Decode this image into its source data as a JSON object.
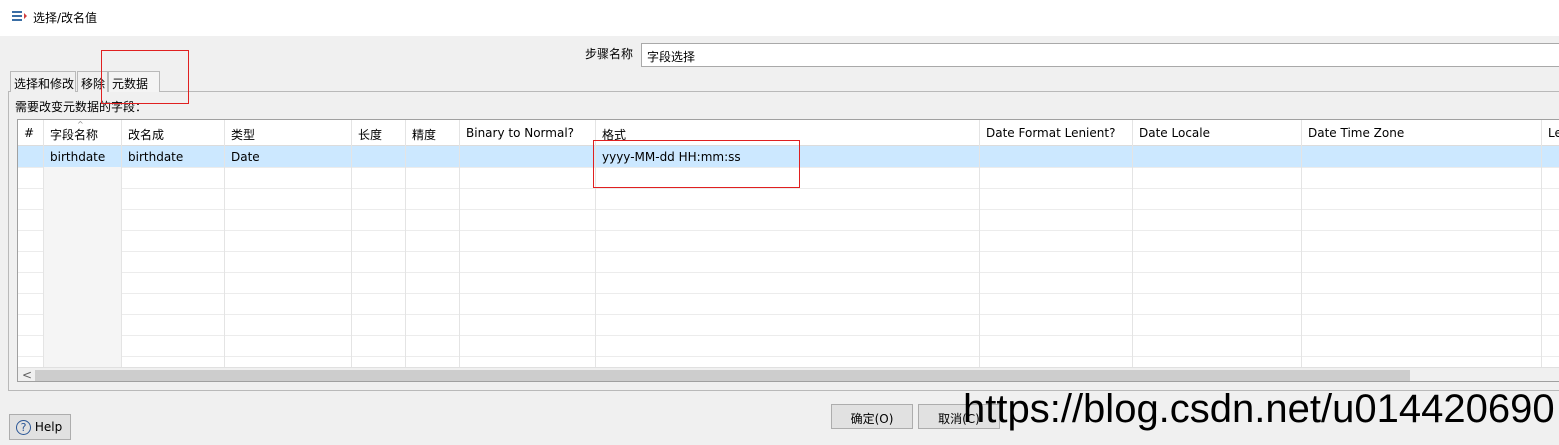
{
  "window": {
    "title": "选择/改名值"
  },
  "step": {
    "label": "步骤名称",
    "value": "字段选择"
  },
  "tabs": [
    {
      "label": "选择和修改",
      "active": false
    },
    {
      "label": "移除",
      "active": false
    },
    {
      "label": "元数据",
      "active": true
    }
  ],
  "fields_label": "需要改变元数据的字段：",
  "table": {
    "columns": [
      "#",
      "字段名称",
      "改名成",
      "类型",
      "长度",
      "精度",
      "Binary to Normal?",
      "格式",
      "Date Format Lenient?",
      "Date Locale",
      "Date Time Zone",
      "Le"
    ],
    "rows": [
      {
        "num": "",
        "field": "birthdate",
        "rename": "birthdate",
        "type": "Date",
        "length": "",
        "precision": "",
        "binary": "",
        "format": "yyyy-MM-dd HH:mm:ss",
        "lenient": "",
        "locale": "",
        "timezone": ""
      }
    ]
  },
  "buttons": {
    "ok": "确定(O)",
    "cancel": "取消(C)",
    "help": "Help"
  },
  "watermark": "https://blog.csdn.net/u014420690",
  "colors": {
    "selected_row": "#cce8ff",
    "highlight_box": "#e02020"
  }
}
